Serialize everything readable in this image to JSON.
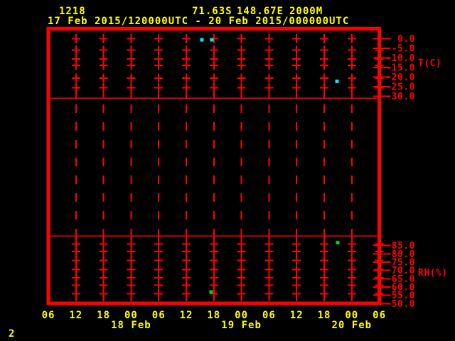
{
  "colors": {
    "background": "#000000",
    "red": "#ff0000",
    "yellow": "#ffff00",
    "cyan": "#00e8e8",
    "green": "#00d400"
  },
  "header": {
    "station_id": "1218",
    "latitude": "71.63S",
    "longitude": "148.67E",
    "elevation": "2000M",
    "period": "17 Feb 2015/120000UTC - 20 Feb 2015/000000UTC"
  },
  "footer": {
    "page_number": "2"
  },
  "chart_data": {
    "type": "scatter",
    "description": "Meteogram time series with temperature panel (top), blank middle panel with dashed gridlines, and relative humidity panel (bottom); red + marks form 6-hourly grid columns, cyan squares are temperature observations, green squares are RH observations",
    "x_axis": {
      "tick_labels": [
        "06",
        "12",
        "18",
        "00",
        "06",
        "12",
        "18",
        "00",
        "06",
        "12",
        "18",
        "00",
        "06"
      ],
      "hours_per_tick": 6,
      "date_labels": [
        {
          "label": "18 Feb",
          "tick_index": 3
        },
        {
          "label": "19 Feb",
          "tick_index": 7
        },
        {
          "label": "20 Feb",
          "tick_index": 11
        }
      ]
    },
    "temp_axis": {
      "label": "T(C)",
      "range": [
        0,
        -30
      ],
      "ticks": [
        {
          "value": 0,
          "label": "0.0"
        },
        {
          "value": -5,
          "label": "-5.0"
        },
        {
          "value": -10,
          "label": "-10.0"
        },
        {
          "value": -15,
          "label": "-15.0"
        },
        {
          "value": -20,
          "label": "-20.0"
        },
        {
          "value": -25,
          "label": "-25.0"
        },
        {
          "value": -30,
          "label": "-30.0"
        }
      ]
    },
    "rh_axis": {
      "label": "RH(%)",
      "range": [
        87,
        50
      ],
      "ticks": [
        {
          "value": 85,
          "label": "85.0"
        },
        {
          "value": 80,
          "label": "80.0"
        },
        {
          "value": 75,
          "label": "75.0"
        },
        {
          "value": 70,
          "label": "70.0"
        },
        {
          "value": 65,
          "label": "65.0"
        },
        {
          "value": 60,
          "label": "60.0"
        },
        {
          "value": 55,
          "label": "55.0"
        },
        {
          "value": 50,
          "label": "50.0"
        }
      ]
    },
    "plus_columns": {
      "tick_indices": [
        1,
        2,
        3,
        4,
        5,
        6,
        7,
        8,
        9,
        10,
        11,
        12
      ],
      "temp_values": [
        0,
        -6,
        -10.5,
        -14,
        -20.5,
        -25.5
      ],
      "rh_values": [
        86,
        81.5,
        76,
        70.5,
        65.5,
        61,
        56
      ]
    },
    "temp_observations": [
      {
        "hours": 33.4,
        "value": -0.6
      },
      {
        "hours": 35.6,
        "value": -0.6
      },
      {
        "hours": 62.8,
        "value": -22.2
      }
    ],
    "rh_observations": [
      {
        "hours": 35.4,
        "value": 57.0
      },
      {
        "hours": 62.9,
        "value": 86.7
      }
    ]
  }
}
